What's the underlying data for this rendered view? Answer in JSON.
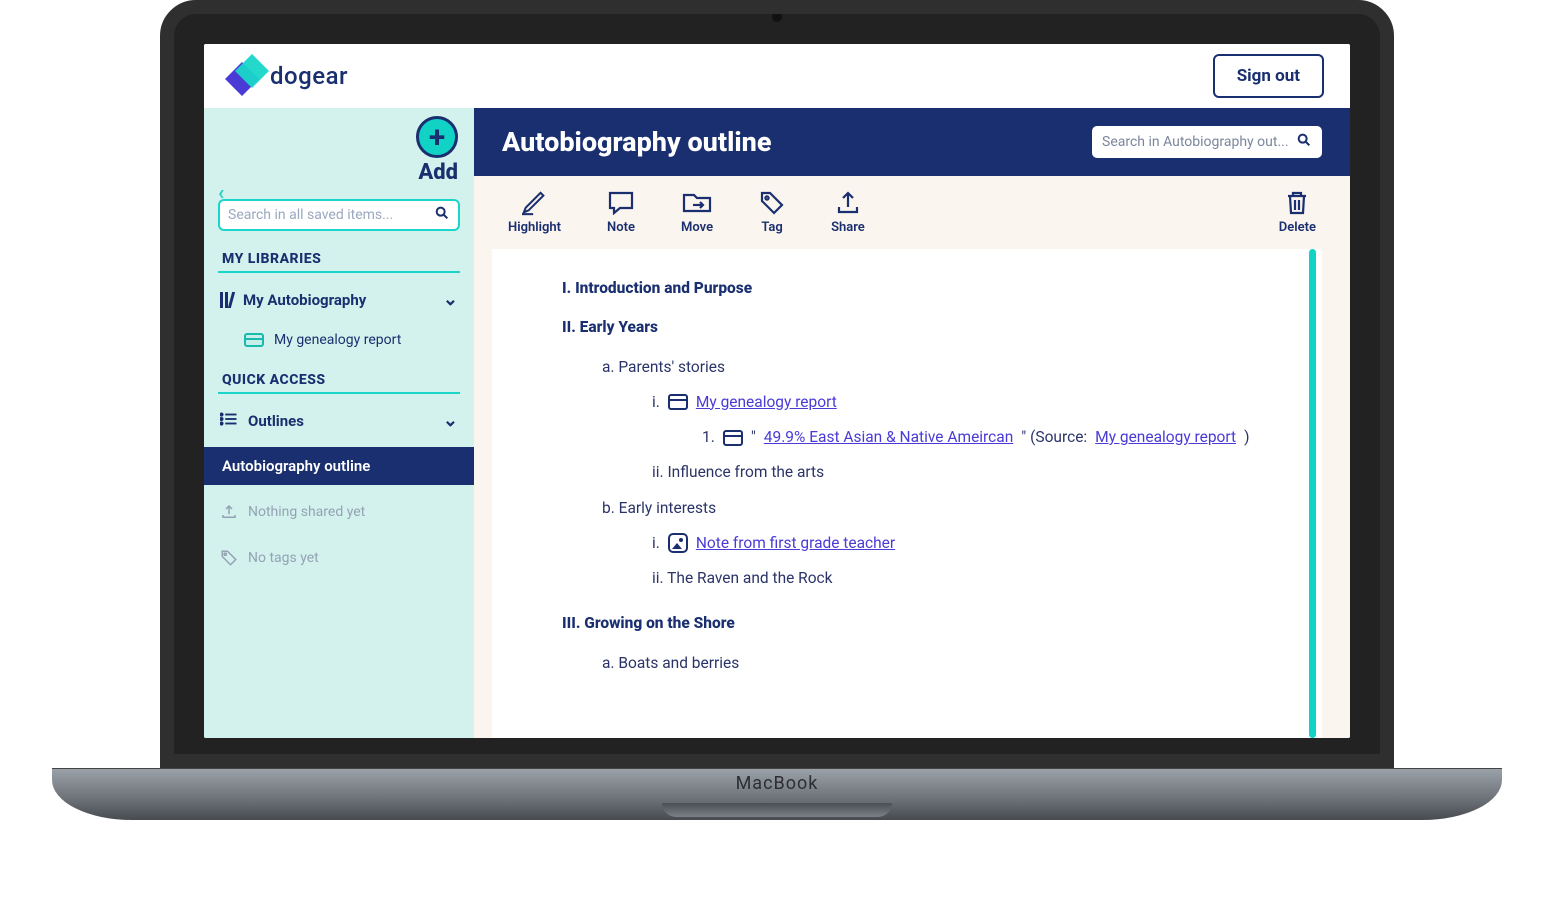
{
  "logo_text": "dogear",
  "sign_out": "Sign out",
  "device_label": "MacBook",
  "sidebar": {
    "add_label": "Add",
    "back_chevron": "‹",
    "search_placeholder": "Search in all saved items...",
    "sec_libraries": "MY LIBRARIES",
    "lib_name": "My Autobiography",
    "lib_child": "My genealogy report",
    "sec_quick": "QUICK ACCESS",
    "outlines_label": "Outlines",
    "outline_active": "Autobiography outline",
    "shared_empty": "Nothing shared yet",
    "tags_empty": "No tags yet"
  },
  "main": {
    "title": "Autobiography outline",
    "search_placeholder": "Search in Autobiography out..."
  },
  "toolbar": {
    "highlight": "Highlight",
    "note": "Note",
    "move": "Move",
    "tag": "Tag",
    "share": "Share",
    "delete": "Delete"
  },
  "doc": {
    "h1": "I. Introduction and Purpose",
    "h2": "II. Early Years",
    "a_parents": "a. Parents' stories",
    "i_prefix": "i.",
    "geno_link": "My genealogy report",
    "one_prefix": "1.",
    "quote_open": "\"",
    "quote_link": "49.9% East Asian & Native Ameircan",
    "quote_after": "\" (Source: ",
    "quote_source": "My genealogy report",
    "quote_close": ")",
    "ii_arts": "ii. Influence from the arts",
    "b_early": "b. Early interests",
    "note_link": "Note from first grade teacher",
    "ii_raven": "ii. The Raven and the Rock",
    "h3": "III. Growing on the Shore",
    "a_boats": "a. Boats and berries"
  }
}
